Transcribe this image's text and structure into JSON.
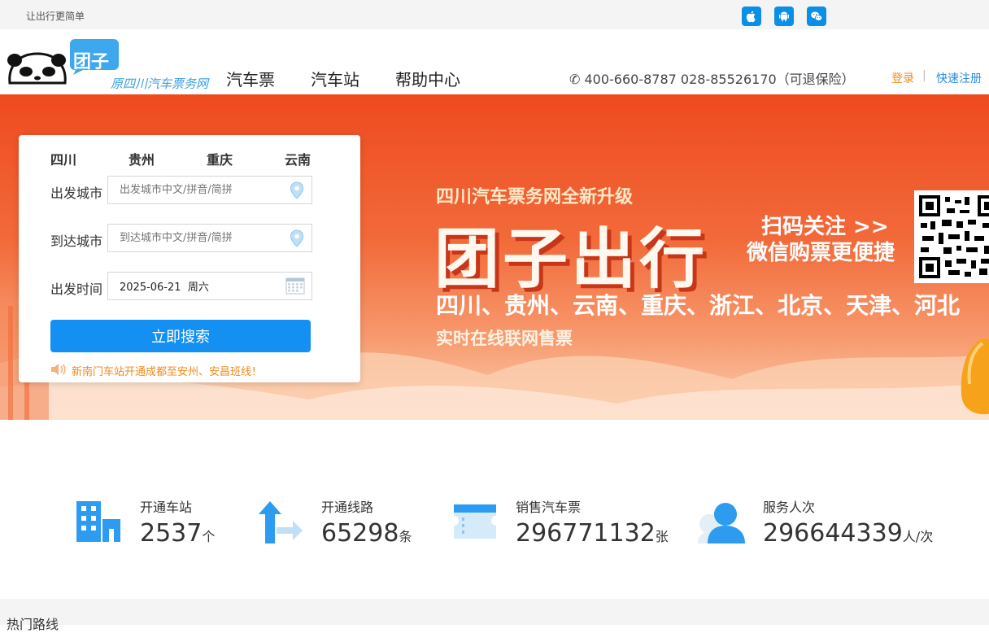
{
  "topbar": {
    "slogan": "让出行更简单",
    "apps": [
      "apple-icon",
      "android-icon",
      "wechat-icon"
    ]
  },
  "header": {
    "logo_badge": "团子",
    "logo_subtitle": "原四川汽车票务网",
    "nav": [
      "汽车票",
      "汽车站",
      "帮助中心"
    ],
    "phone": "✆ 400-660-8787 028-85526170（可退保险）",
    "login": "登录",
    "separator": "|",
    "register": "快速注册"
  },
  "banner": {
    "title_small": "四川汽车票务网全新升级",
    "title_big": "团子出行",
    "scan_line1": "扫码关注 >>",
    "scan_line2": "微信购票更便捷",
    "regions": "四川、贵州、云南、重庆、浙江、北京、天津、河北",
    "realtime": "实时在线联网售票"
  },
  "search": {
    "tabs": [
      "四川",
      "贵州",
      "重庆",
      "云南"
    ],
    "from_label": "出发城市",
    "from_placeholder": "出发城市中文/拼音/简拼",
    "to_label": "到达城市",
    "to_placeholder": "到达城市中文/拼音/简拼",
    "date_label": "出发时间",
    "date_value": "2025-06-21  周六",
    "button": "立即搜索",
    "notice": "新南门车站开通成都至安州、安昌班线！"
  },
  "stats": [
    {
      "label": "开通车站",
      "value": "2537",
      "unit": "个",
      "icon": "building-icon"
    },
    {
      "label": "开通线路",
      "value": "65298",
      "unit": "条",
      "icon": "route-arrow-icon"
    },
    {
      "label": "销售汽车票",
      "value": "296771132",
      "unit": "张",
      "icon": "ticket-icon"
    },
    {
      "label": "服务人次",
      "value": "296644339",
      "unit": "人/次",
      "icon": "user-icon"
    }
  ],
  "hot_routes": {
    "title": "热门路线"
  },
  "colors": {
    "brand_blue": "#1390f2",
    "accent_orange": "#f08a1c",
    "banner_red": "#ee4a1f"
  }
}
